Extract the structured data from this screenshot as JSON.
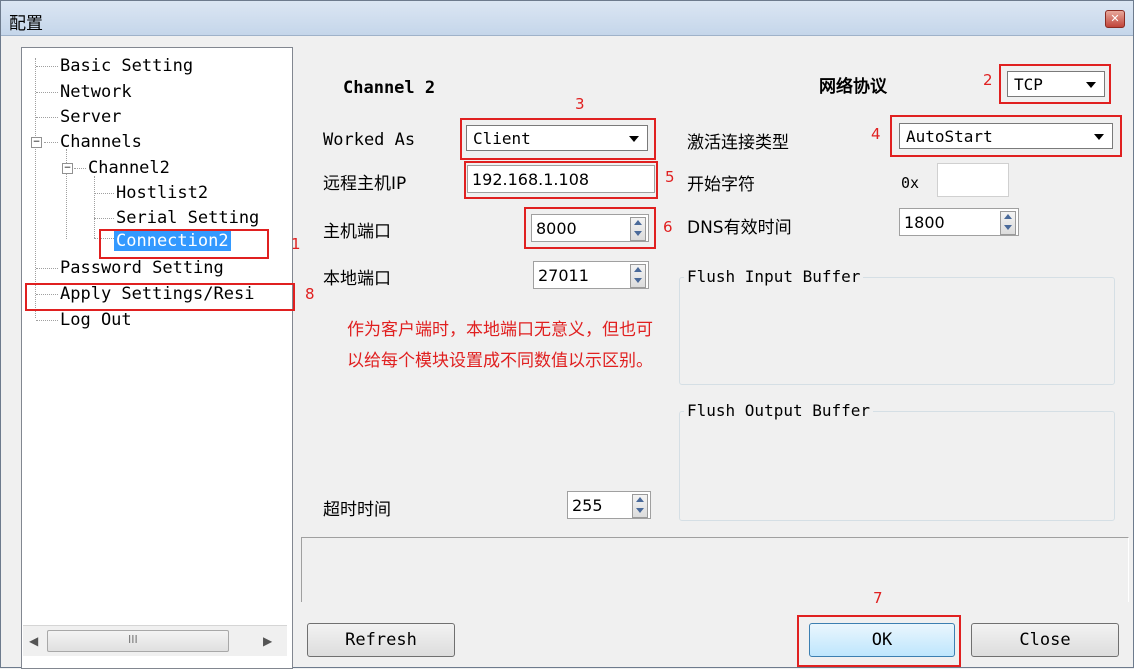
{
  "window": {
    "title": "配置",
    "close_icon": "close-icon"
  },
  "tree": {
    "items": [
      {
        "label": "Basic Setting"
      },
      {
        "label": "Network"
      },
      {
        "label": "Server"
      },
      {
        "label": "Channels"
      },
      {
        "label": "Channel2"
      },
      {
        "label": "Hostlist2"
      },
      {
        "label": "Serial Setting"
      },
      {
        "label": "Connection2"
      },
      {
        "label": "Password Setting"
      },
      {
        "label": "Apply Settings/Resi"
      },
      {
        "label": "Log Out"
      }
    ],
    "expander_minus": "−",
    "scroll_mid": "III"
  },
  "panel": {
    "channel_title": "Channel 2",
    "protocol_label": "网络协议",
    "protocol_value": "TCP",
    "worked_as_label": "Worked As",
    "worked_as_value": "Client",
    "activation_label": "激活连接类型",
    "activation_value": "AutoStart",
    "remote_ip_label": "远程主机IP",
    "remote_ip_value": "192.168.1.108",
    "start_char_label": "开始字符",
    "start_char_prefix": "0x",
    "start_char_value": "",
    "host_port_label": "主机端口",
    "host_port_value": "8000",
    "dns_label": "DNS有效时间",
    "dns_value": "1800",
    "local_port_label": "本地端口",
    "local_port_value": "27011",
    "flush_input_label": "Flush Input Buffer",
    "flush_output_label": "Flush Output Buffer",
    "timeout_label": "超时时间",
    "timeout_value": "255"
  },
  "annotation": {
    "note_line1": "作为客户端时，本地端口无意义，但也可",
    "note_line2": "以给每个模块设置成不同数值以示区别。",
    "n1": "1",
    "n2": "2",
    "n3": "3",
    "n4": "4",
    "n5": "5",
    "n6": "6",
    "n7": "7",
    "n8": "8",
    "color": "#e02020"
  },
  "buttons": {
    "refresh": "Refresh",
    "ok": "OK",
    "close": "Close"
  }
}
